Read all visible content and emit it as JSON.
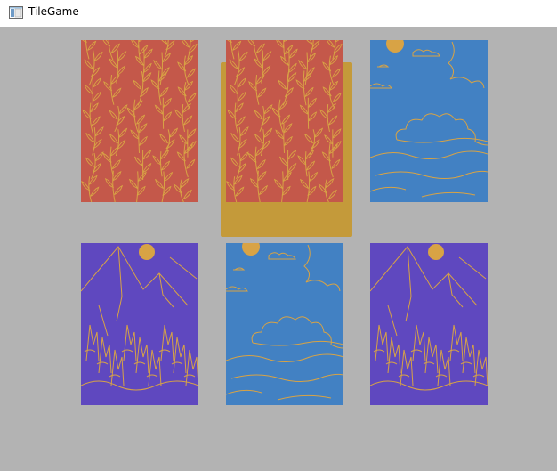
{
  "window": {
    "title": "TileGame",
    "icon": "app-window-icon"
  },
  "colors": {
    "background": "#b3b3b3",
    "selection": "#c49a3a",
    "line": "#d8a345",
    "red": "#c4584a",
    "blue": "#4281c3",
    "purple": "#5f48bf"
  },
  "tiles": [
    {
      "pattern": "leaves",
      "selected": false
    },
    {
      "pattern": "leaves",
      "selected": true
    },
    {
      "pattern": "sky",
      "selected": false
    },
    {
      "pattern": "mountains",
      "selected": false
    },
    {
      "pattern": "sky",
      "selected": false
    },
    {
      "pattern": "mountains",
      "selected": false
    }
  ]
}
